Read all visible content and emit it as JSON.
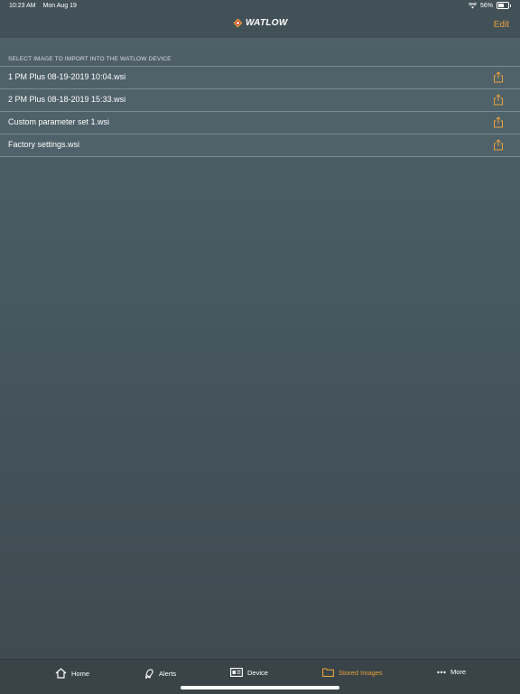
{
  "status_bar": {
    "time": "10:23 AM",
    "date": "Mon Aug 19",
    "battery": "56%",
    "battery_level": 0.56
  },
  "nav": {
    "logo_text": "WATLOW",
    "edit_label": "Edit"
  },
  "section_header": "SELECT IMAGE TO IMPORT INTO THE WATLOW DEVICE",
  "files": [
    {
      "name": "1 PM Plus 08-19-2019 10:04.wsi"
    },
    {
      "name": "2 PM Plus 08-18-2019 15:33.wsi"
    },
    {
      "name": "Custom parameter set 1.wsi"
    },
    {
      "name": "Factory settings.wsi"
    }
  ],
  "tabs": [
    {
      "label": "Home",
      "icon": "home-icon"
    },
    {
      "label": "Alerts",
      "icon": "bell-icon"
    },
    {
      "label": "Device",
      "icon": "device-icon"
    },
    {
      "label": "Stored Images",
      "icon": "folder-icon",
      "active": true
    },
    {
      "label": "More",
      "icon": "more-dots-icon"
    }
  ],
  "colors": {
    "accent": "#e9a23b",
    "background": "#4f6169",
    "tab_bar": "#394348"
  }
}
